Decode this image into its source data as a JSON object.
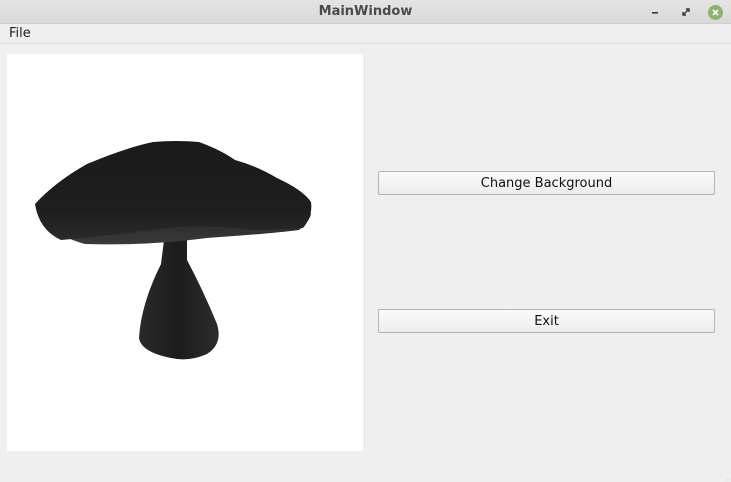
{
  "window": {
    "title": "MainWindow"
  },
  "menubar": {
    "items": [
      {
        "label": "File"
      }
    ]
  },
  "viewport": {
    "background": "#ffffff",
    "model_color": "#1e1e1e"
  },
  "buttons": {
    "change_background_label": "Change Background",
    "exit_label": "Exit"
  }
}
